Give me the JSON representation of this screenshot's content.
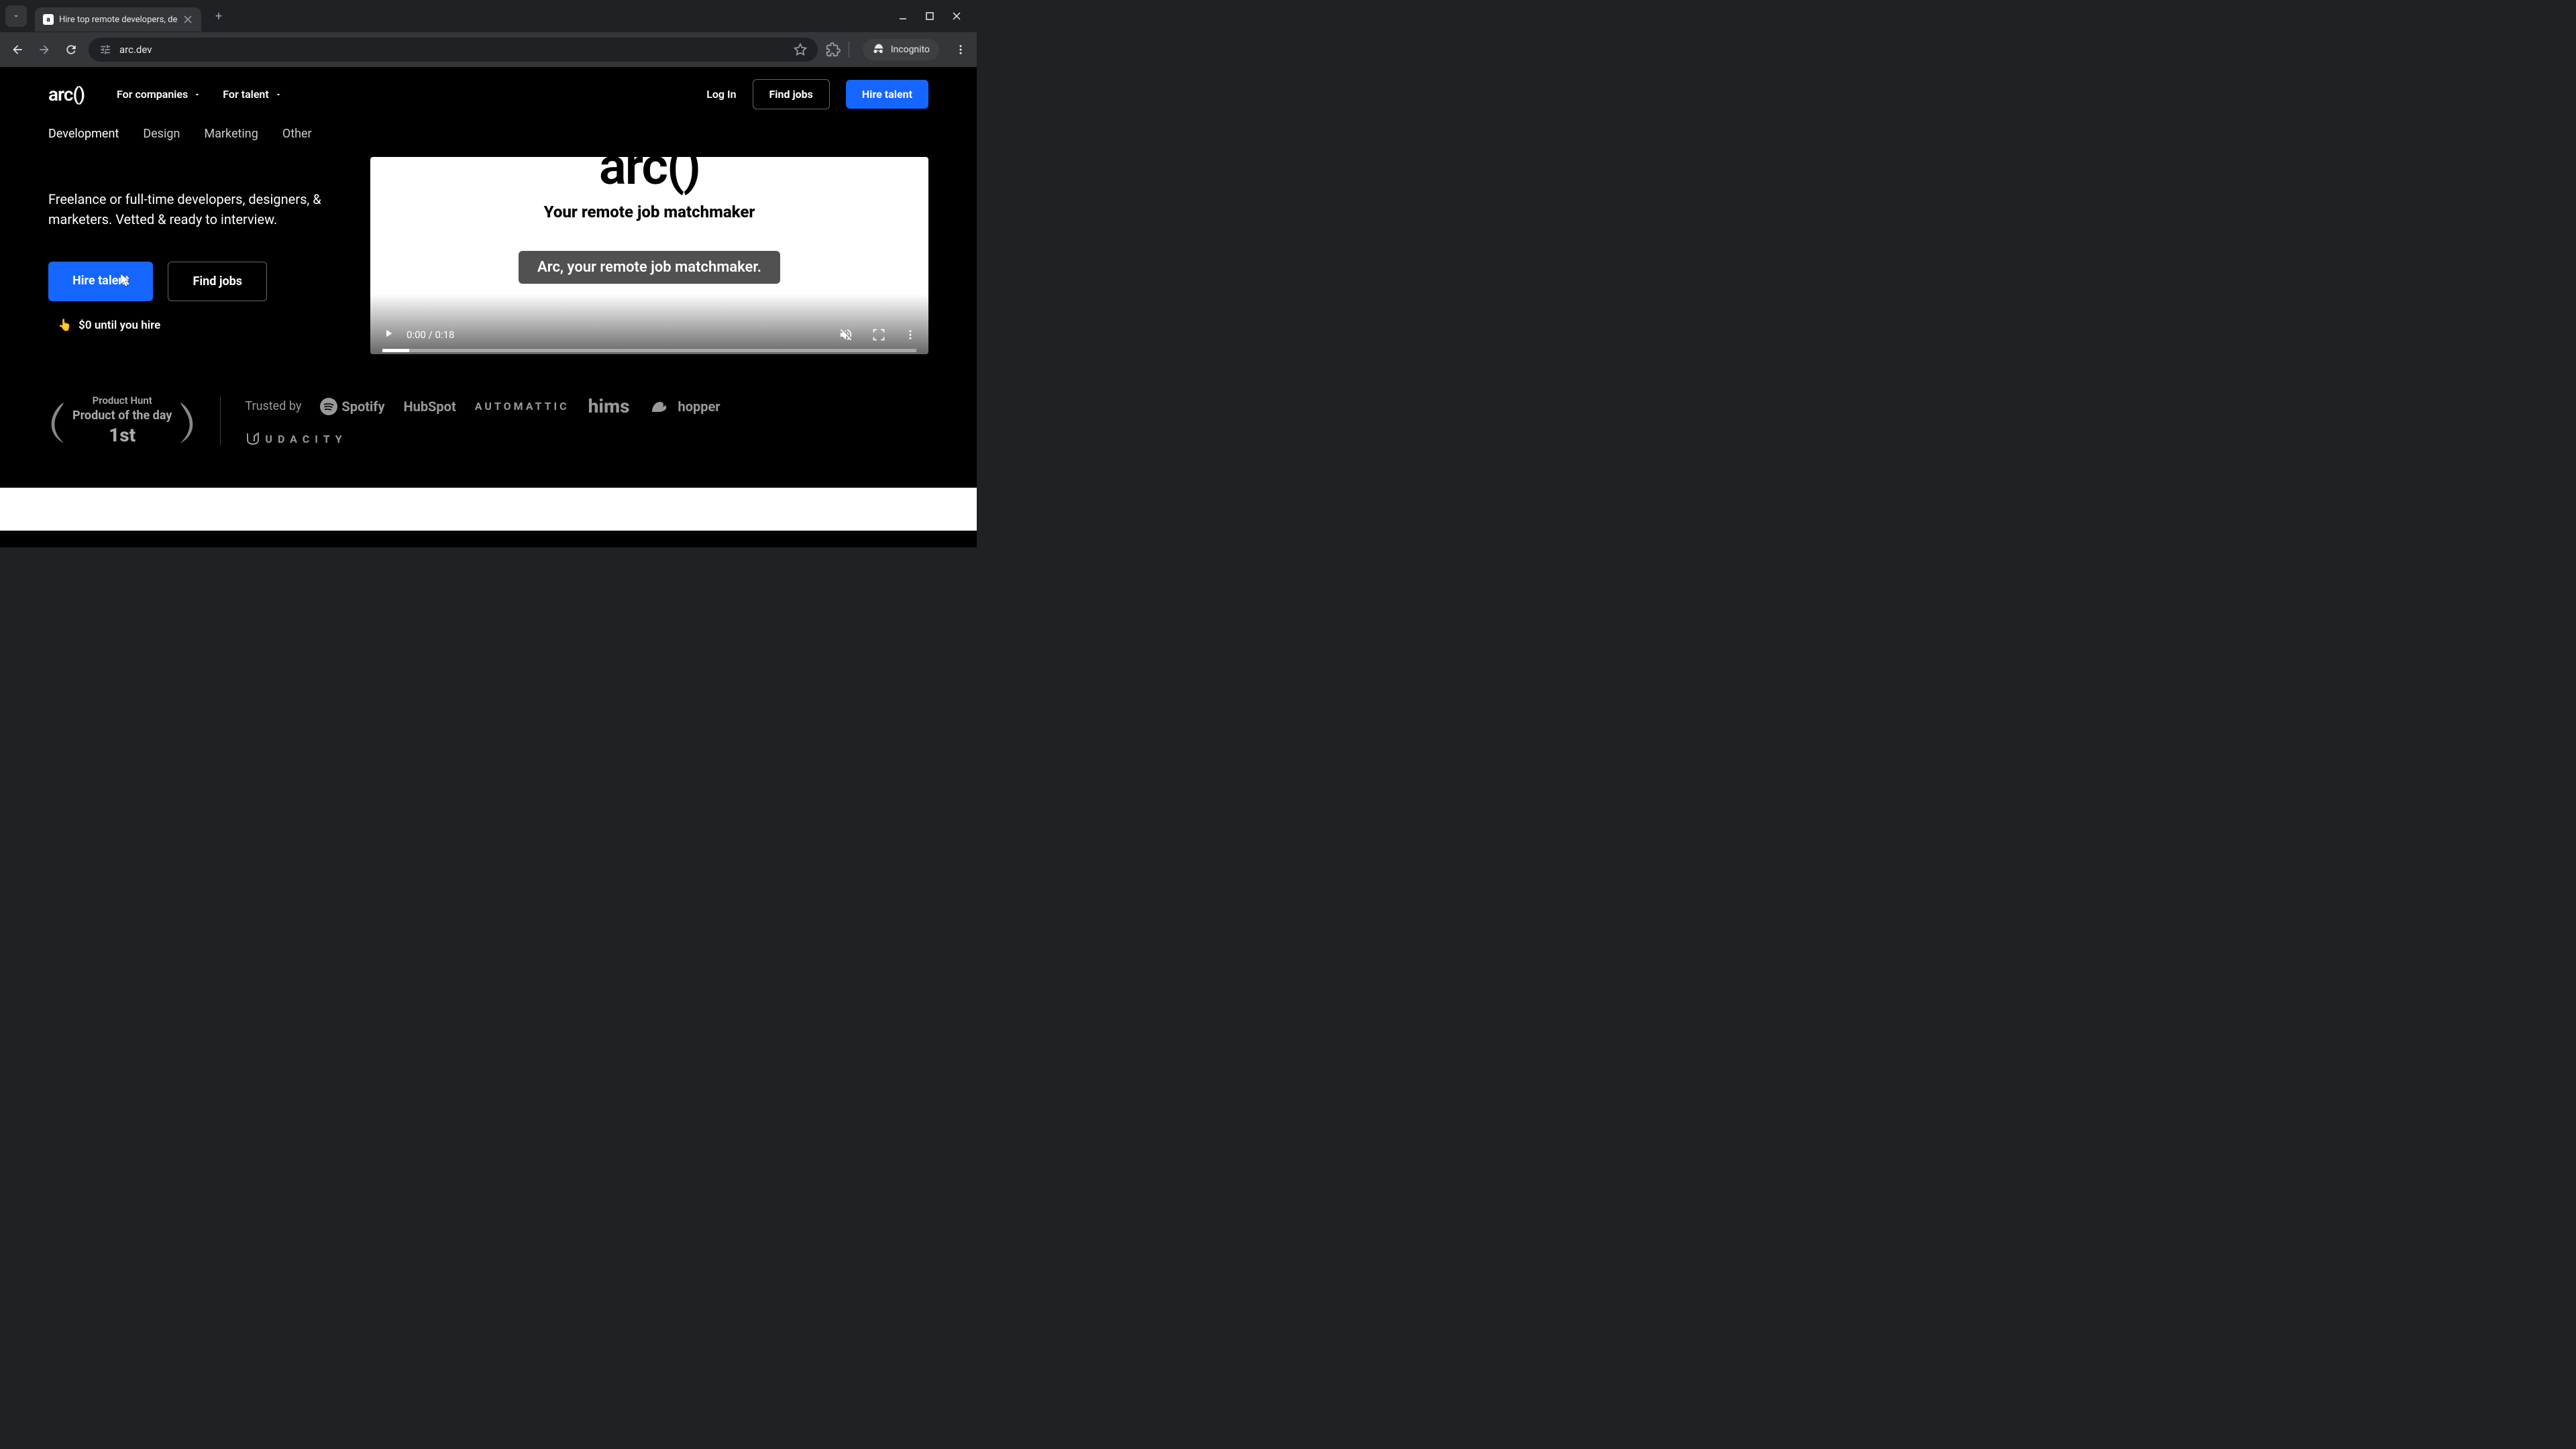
{
  "browser": {
    "tab_title": "Hire top remote developers, de",
    "url": "arc.dev",
    "incognito_label": "Incognito"
  },
  "header": {
    "logo": "arc()",
    "nav": {
      "for_companies": "For companies",
      "for_talent": "For talent"
    },
    "login": "Log In",
    "find_jobs": "Find jobs",
    "hire_talent": "Hire talent"
  },
  "categories": {
    "development": "Development",
    "design": "Design",
    "marketing": "Marketing",
    "other": "Other"
  },
  "hero": {
    "subtitle": "Freelance or full-time developers, designers, & marketers. Vetted & ready to interview.",
    "hire_talent": "Hire talent",
    "find_jobs": "Find jobs",
    "price_note_emoji": "👆",
    "price_note": "$0 until you hire"
  },
  "video": {
    "logo": "arc()",
    "tagline": "Your remote job matchmaker",
    "caption": "Arc, your remote job matchmaker.",
    "time": "0:00 / 0:18"
  },
  "trust": {
    "laurel_line1": "Product Hunt",
    "laurel_line2": "Product of the day",
    "laurel_line3": "1st",
    "trusted_by": "Trusted by",
    "brands": {
      "spotify": "Spotify",
      "hubspot": "HubSpot",
      "automattic": "AUTOMATTIC",
      "hims": "hims",
      "hopper": "hopper",
      "udacity": "UDACITY"
    }
  }
}
